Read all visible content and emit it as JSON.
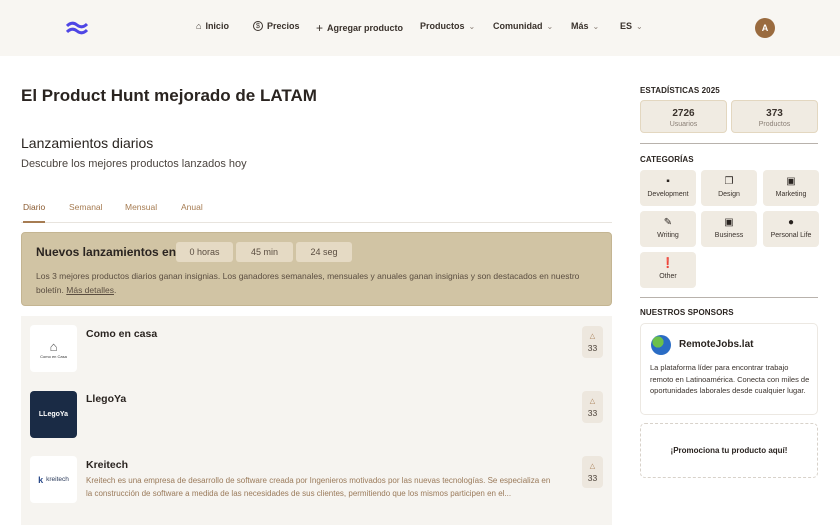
{
  "header": {
    "nav": [
      {
        "label": "Inicio",
        "icon": "home-icon"
      },
      {
        "label": "Precios",
        "icon": "dollar-icon"
      },
      {
        "label": "Agregar producto",
        "icon": "plus-icon"
      },
      {
        "label": "Productos"
      },
      {
        "label": "Comunidad"
      },
      {
        "label": "Más"
      },
      {
        "label": "ES"
      }
    ],
    "avatar": "A"
  },
  "main": {
    "title": "El Product Hunt mejorado de LATAM",
    "section_title": "Lanzamientos diarios",
    "subtitle": "Descubre los mejores productos lanzados hoy",
    "tabs": [
      "Diario",
      "Semanal",
      "Mensual",
      "Anual"
    ],
    "banner": {
      "title": "Nuevos lanzamientos en",
      "hours": "0 horas",
      "minutes": "45 min",
      "seconds": "24 seg",
      "text": "Los 3 mejores productos diarios ganan insignias. Los ganadores semanales, mensuales y anuales ganan insignias y son destacados en nuestro boletín.",
      "link": "Más detalles"
    },
    "products": [
      {
        "name": "Como en casa",
        "logo_text": "Como en Casa",
        "description": "",
        "votes": "33"
      },
      {
        "name": "LlegoYa",
        "logo_text": "LLegoYa",
        "description": "",
        "votes": "33"
      },
      {
        "name": "Kreitech",
        "logo_text": "kreitech",
        "description": "Kreitech es una empresa de desarrollo de software creada por Ingenieros motivados por las nuevas tecnologías. Se especializa en la construcción de software a medida de las necesidades de sus clientes, permitiendo que los mismos participen en el...",
        "votes": "33"
      }
    ]
  },
  "sidebar": {
    "stats_title": "ESTADÍSTICAS 2025",
    "stats": [
      {
        "value": "2726",
        "label": "Usuarios"
      },
      {
        "value": "373",
        "label": "Productos"
      }
    ],
    "categories_title": "CATEGORÍAS",
    "categories": [
      "Development",
      "Design",
      "Marketing",
      "Writing",
      "Business",
      "Personal Life",
      "Other"
    ],
    "sponsors_title": "NUESTROS SPONSORS",
    "sponsor": {
      "name": "RemoteJobs.lat",
      "description": "La plataforma líder para encontrar trabajo remoto en Latinoamérica. Conecta con miles de oportunidades laborales desde cualquier lugar."
    },
    "promo": "¡Promociona tu producto aquí!"
  },
  "colors": {
    "accent": "#a67c52",
    "banner": "#d1c4a4",
    "header_bg": "#f8f6f2"
  }
}
